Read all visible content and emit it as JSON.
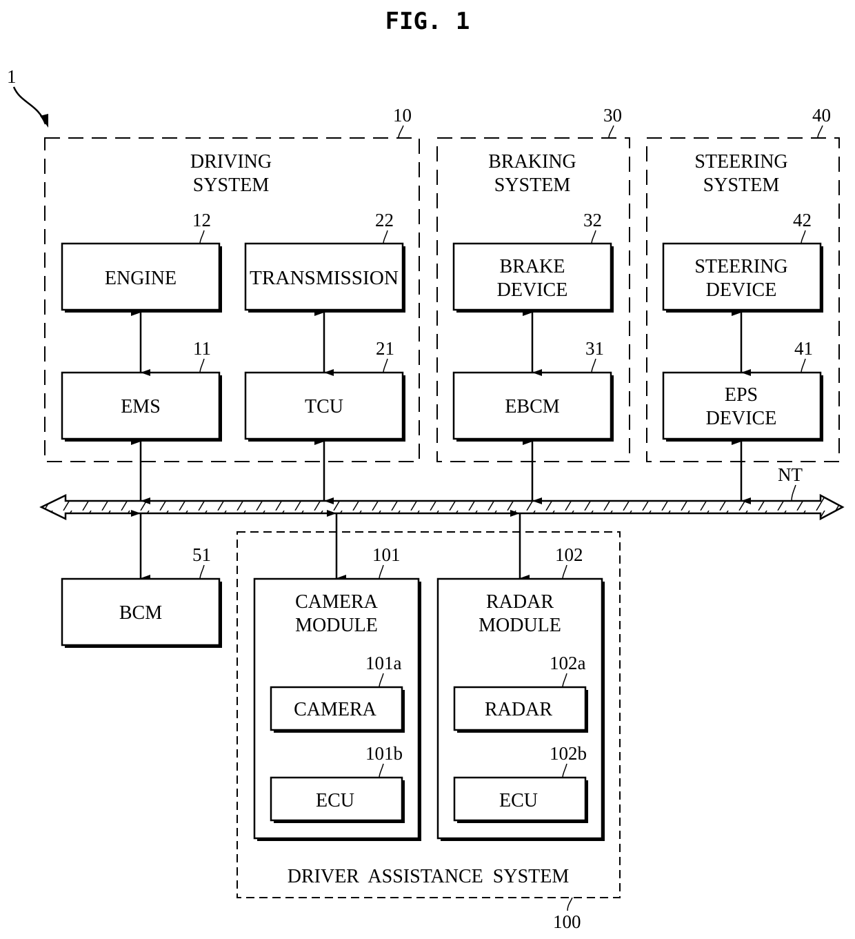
{
  "figure_title": "FIG. 1",
  "system_ref": "1",
  "network": {
    "ref": "NT"
  },
  "groups": {
    "driving": {
      "ref": "10",
      "line1": "DRIVING",
      "line2": "SYSTEM"
    },
    "braking": {
      "ref": "30",
      "line1": "BRAKING",
      "line2": "SYSTEM"
    },
    "steering": {
      "ref": "40",
      "line1": "STEERING",
      "line2": "SYSTEM"
    },
    "das": {
      "ref": "100",
      "label": "DRIVER  ASSISTANCE  SYSTEM"
    }
  },
  "blocks": {
    "engine": {
      "ref": "12",
      "label": "ENGINE"
    },
    "transmission": {
      "ref": "22",
      "label": "TRANSMISSION"
    },
    "brake_device": {
      "ref": "32",
      "line1": "BRAKE",
      "line2": "DEVICE"
    },
    "steering_device": {
      "ref": "42",
      "line1": "STEERING",
      "line2": "DEVICE"
    },
    "ems": {
      "ref": "11",
      "label": "EMS"
    },
    "tcu": {
      "ref": "21",
      "label": "TCU"
    },
    "ebcm": {
      "ref": "31",
      "label": "EBCM"
    },
    "eps": {
      "ref": "41",
      "line1": "EPS",
      "line2": "DEVICE"
    },
    "bcm": {
      "ref": "51",
      "label": "BCM"
    },
    "camera_module": {
      "ref": "101",
      "line1": "CAMERA",
      "line2": "MODULE"
    },
    "radar_module": {
      "ref": "102",
      "line1": "RADAR",
      "line2": "MODULE"
    },
    "camera": {
      "ref": "101a",
      "label": "CAMERA"
    },
    "camera_ecu": {
      "ref": "101b",
      "label": "ECU"
    },
    "radar": {
      "ref": "102a",
      "label": "RADAR"
    },
    "radar_ecu": {
      "ref": "102b",
      "label": "ECU"
    }
  }
}
